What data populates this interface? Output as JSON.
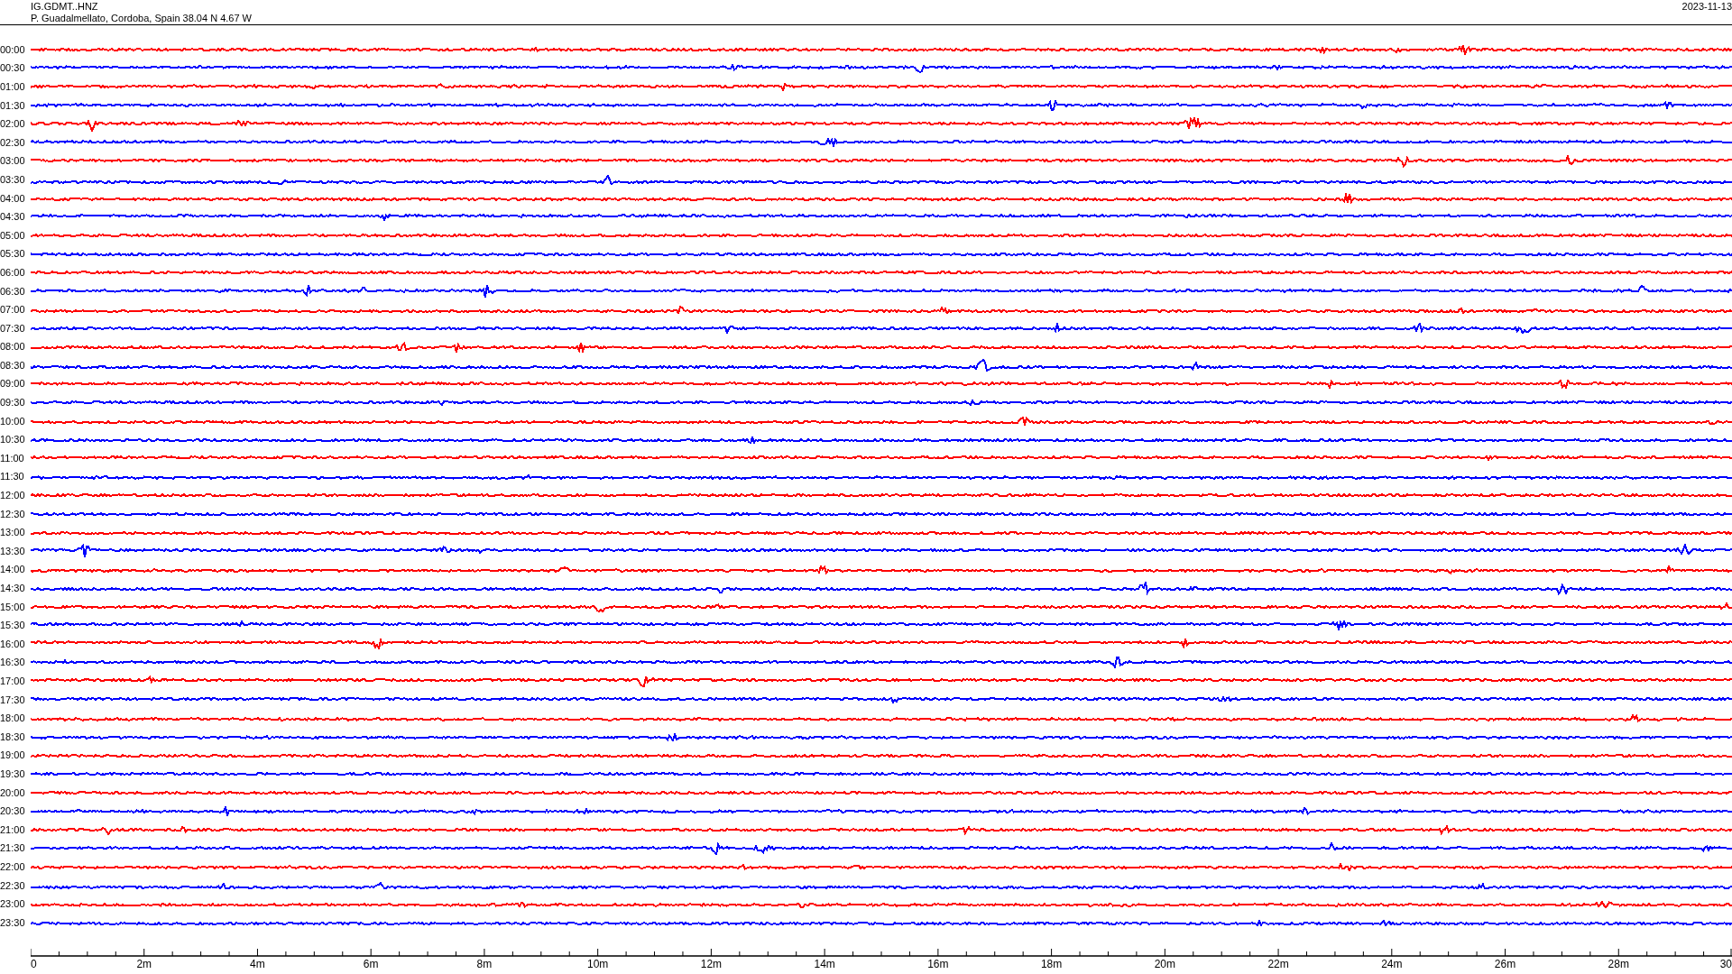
{
  "header": {
    "station": "IG.GDMT..HNZ",
    "location": "P. Guadalmellato, Cordoba, Spain  38.04 N 4.67 W",
    "date": "2023-11-13"
  },
  "traces": [
    {
      "label": "00:00",
      "color": "#ff0000"
    },
    {
      "label": "00:30",
      "color": "#0000ff"
    },
    {
      "label": "01:00",
      "color": "#ff0000"
    },
    {
      "label": "01:30",
      "color": "#0000ff"
    },
    {
      "label": "02:00",
      "color": "#ff0000"
    },
    {
      "label": "02:30",
      "color": "#0000ff"
    },
    {
      "label": "03:00",
      "color": "#ff0000"
    },
    {
      "label": "03:30",
      "color": "#0000ff"
    },
    {
      "label": "04:00",
      "color": "#ff0000"
    },
    {
      "label": "04:30",
      "color": "#0000ff"
    },
    {
      "label": "05:00",
      "color": "#ff0000"
    },
    {
      "label": "05:30",
      "color": "#0000ff"
    },
    {
      "label": "06:00",
      "color": "#ff0000"
    },
    {
      "label": "06:30",
      "color": "#0000ff"
    },
    {
      "label": "07:00",
      "color": "#ff0000"
    },
    {
      "label": "07:30",
      "color": "#0000ff"
    },
    {
      "label": "08:00",
      "color": "#ff0000"
    },
    {
      "label": "08:30",
      "color": "#0000ff"
    },
    {
      "label": "09:00",
      "color": "#ff0000"
    },
    {
      "label": "09:30",
      "color": "#0000ff"
    },
    {
      "label": "10:00",
      "color": "#ff0000"
    },
    {
      "label": "10:30",
      "color": "#0000ff"
    },
    {
      "label": "11:00",
      "color": "#ff0000"
    },
    {
      "label": "11:30",
      "color": "#0000ff"
    },
    {
      "label": "12:00",
      "color": "#ff0000"
    },
    {
      "label": "12:30",
      "color": "#0000ff"
    },
    {
      "label": "13:00",
      "color": "#ff0000"
    },
    {
      "label": "13:30",
      "color": "#0000ff"
    },
    {
      "label": "14:00",
      "color": "#ff0000"
    },
    {
      "label": "14:30",
      "color": "#0000ff"
    },
    {
      "label": "15:00",
      "color": "#ff0000"
    },
    {
      "label": "15:30",
      "color": "#0000ff"
    },
    {
      "label": "16:00",
      "color": "#ff0000"
    },
    {
      "label": "16:30",
      "color": "#0000ff"
    },
    {
      "label": "17:00",
      "color": "#ff0000"
    },
    {
      "label": "17:30",
      "color": "#0000ff"
    },
    {
      "label": "18:00",
      "color": "#ff0000"
    },
    {
      "label": "18:30",
      "color": "#0000ff"
    },
    {
      "label": "19:00",
      "color": "#ff0000"
    },
    {
      "label": "19:30",
      "color": "#0000ff"
    },
    {
      "label": "20:00",
      "color": "#ff0000"
    },
    {
      "label": "20:30",
      "color": "#0000ff"
    },
    {
      "label": "21:00",
      "color": "#ff0000"
    },
    {
      "label": "21:30",
      "color": "#0000ff"
    },
    {
      "label": "22:00",
      "color": "#ff0000"
    },
    {
      "label": "22:30",
      "color": "#0000ff"
    },
    {
      "label": "23:00",
      "color": "#ff0000"
    },
    {
      "label": "23:30",
      "color": "#0000ff"
    }
  ],
  "x_axis": {
    "labels": [
      "0",
      "2m",
      "4m",
      "6m",
      "8m",
      "10m",
      "12m",
      "14m",
      "16m",
      "18m",
      "20m",
      "22m",
      "24m",
      "26m",
      "28m",
      "30"
    ]
  }
}
